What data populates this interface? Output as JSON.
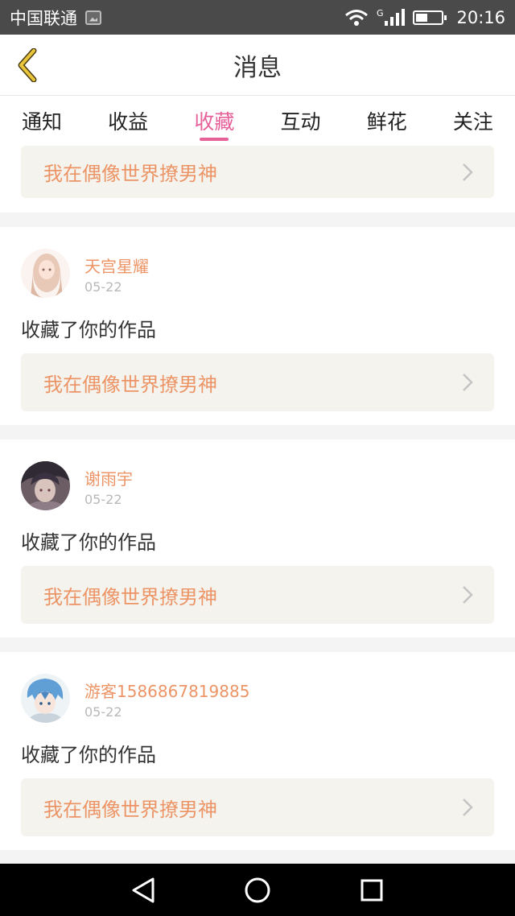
{
  "status_bar": {
    "carrier": "中国联通",
    "time": "20:16",
    "network_type": "G"
  },
  "header": {
    "title": "消息"
  },
  "tabs": [
    {
      "label": "通知",
      "active": false
    },
    {
      "label": "收益",
      "active": false
    },
    {
      "label": "收藏",
      "active": true
    },
    {
      "label": "互动",
      "active": false
    },
    {
      "label": "鲜花",
      "active": false
    },
    {
      "label": "关注",
      "active": false
    }
  ],
  "partial_card": {
    "work_title": "我在偶像世界撩男神"
  },
  "messages": [
    {
      "user": "天宫星耀",
      "date": "05-22",
      "text": "收藏了你的作品",
      "work_title": "我在偶像世界撩男神"
    },
    {
      "user": "谢雨宇",
      "date": "05-22",
      "text": "收藏了你的作品",
      "work_title": "我在偶像世界撩男神"
    },
    {
      "user": "游客1586867819885",
      "date": "05-22",
      "text": "收藏了你的作品",
      "work_title": "我在偶像世界撩男神"
    }
  ],
  "colors": {
    "accent_tab": "#e6609a",
    "link_text": "#ec9466",
    "back_icon": "#e8c53a"
  }
}
